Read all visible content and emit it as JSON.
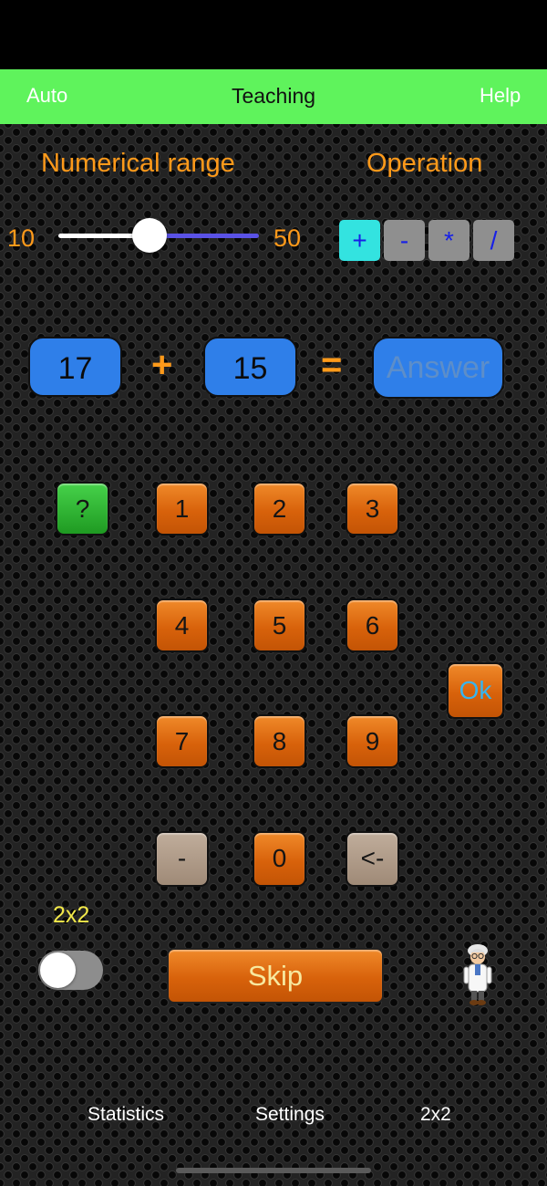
{
  "navbar": {
    "left": "Auto",
    "title": "Teaching",
    "right": "Help"
  },
  "settings": {
    "range_label": "Numerical range",
    "operation_label": "Operation",
    "range_min": "10",
    "range_max": "50",
    "slider_value": 26,
    "operations": [
      "+",
      "-",
      "*",
      "/"
    ],
    "active_operation": "+"
  },
  "problem": {
    "a": "17",
    "operator": "+",
    "b": "15",
    "equals": "=",
    "answer_placeholder": "Answer"
  },
  "keypad": {
    "hint": "?",
    "digits": [
      "1",
      "2",
      "3",
      "4",
      "5",
      "6",
      "7",
      "8",
      "9",
      "0"
    ],
    "minus": "-",
    "backspace": "<-",
    "ok": "Ok"
  },
  "bottom": {
    "toggle_label": "2x2",
    "toggle_on": false,
    "skip": "Skip"
  },
  "tabs": [
    "Statistics",
    "Settings",
    "2x2"
  ],
  "colors": {
    "navbar": "#5ff35c",
    "accent_orange": "#ff9a1a",
    "number_box": "#2f7fe9",
    "active_op": "#33e3e0"
  }
}
